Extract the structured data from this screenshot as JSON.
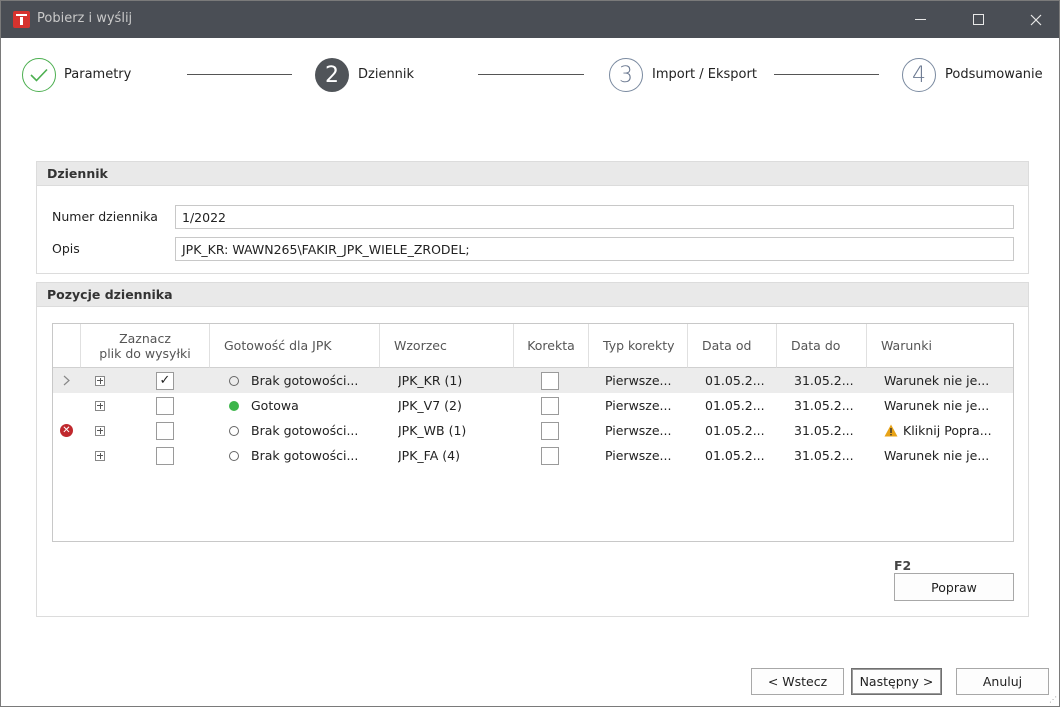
{
  "window": {
    "title": "Pobierz i wyślij",
    "minimize": "minimize",
    "maximize": "maximize",
    "close": "close"
  },
  "steps": [
    {
      "number": "",
      "label": "Parametry",
      "state": "done"
    },
    {
      "number": "2",
      "label": "Dziennik",
      "state": "active"
    },
    {
      "number": "3",
      "label": "Import / Eksport",
      "state": "pending"
    },
    {
      "number": "4",
      "label": "Podsumowanie",
      "state": "pending"
    }
  ],
  "dziennik": {
    "header": "Dziennik",
    "numer_label": "Numer dziennika",
    "numer_value": "1/2022",
    "opis_label": "Opis",
    "opis_value": "JPK_KR: WAWN265\\FAKIR_JPK_WIELE_ZRODEL;"
  },
  "pozycje": {
    "header": "Pozycje dziennika",
    "columns": {
      "zaznacz_line1": "Zaznacz",
      "zaznacz_line2": "plik do wysyłki",
      "gotowosc": "Gotowość dla JPK",
      "wzorzec": "Wzorzec",
      "korekta": "Korekta",
      "typ_korekty": "Typ korekty",
      "data_od": "Data od",
      "data_do": "Data do",
      "warunki": "Warunki"
    },
    "rows": [
      {
        "indicator": "arrow",
        "checked": true,
        "status_icon": "empty",
        "gotowosc": "Brak gotowości...",
        "wzorzec": "JPK_KR (1)",
        "korekta": false,
        "typ_korekty": "Pierwsze...",
        "data_od": "01.05.2...",
        "data_do": "31.05.2...",
        "warunki": "Warunek nie je...",
        "warn": false
      },
      {
        "indicator": "none",
        "checked": false,
        "status_icon": "green",
        "gotowosc": "Gotowa",
        "wzorzec": "JPK_V7 (2)",
        "korekta": false,
        "typ_korekty": "Pierwsze...",
        "data_od": "01.05.2...",
        "data_do": "31.05.2...",
        "warunki": "Warunek nie je...",
        "warn": false
      },
      {
        "indicator": "error",
        "checked": false,
        "status_icon": "empty",
        "gotowosc": "Brak gotowości...",
        "wzorzec": "JPK_WB (1)",
        "korekta": false,
        "typ_korekty": "Pierwsze...",
        "data_od": "01.05.2...",
        "data_do": "31.05.2...",
        "warunki": "Kliknij Popra...",
        "warn": true
      },
      {
        "indicator": "none",
        "checked": false,
        "status_icon": "empty",
        "gotowosc": "Brak gotowości...",
        "wzorzec": "JPK_FA (4)",
        "korekta": false,
        "typ_korekty": "Pierwsze...",
        "data_od": "01.05.2...",
        "data_do": "31.05.2...",
        "warunki": "Warunek nie je...",
        "warn": false
      }
    ],
    "shortcut": "F2",
    "popraw": "Popraw"
  },
  "footer": {
    "back": "< Wstecz",
    "next": "Następny >",
    "cancel": "Anuluj"
  },
  "colors": {
    "titlebar": "#4a4e55",
    "done": "#4caf50",
    "ready": "#3cb54a",
    "error": "#c0282d",
    "warning": "#e8a317"
  }
}
